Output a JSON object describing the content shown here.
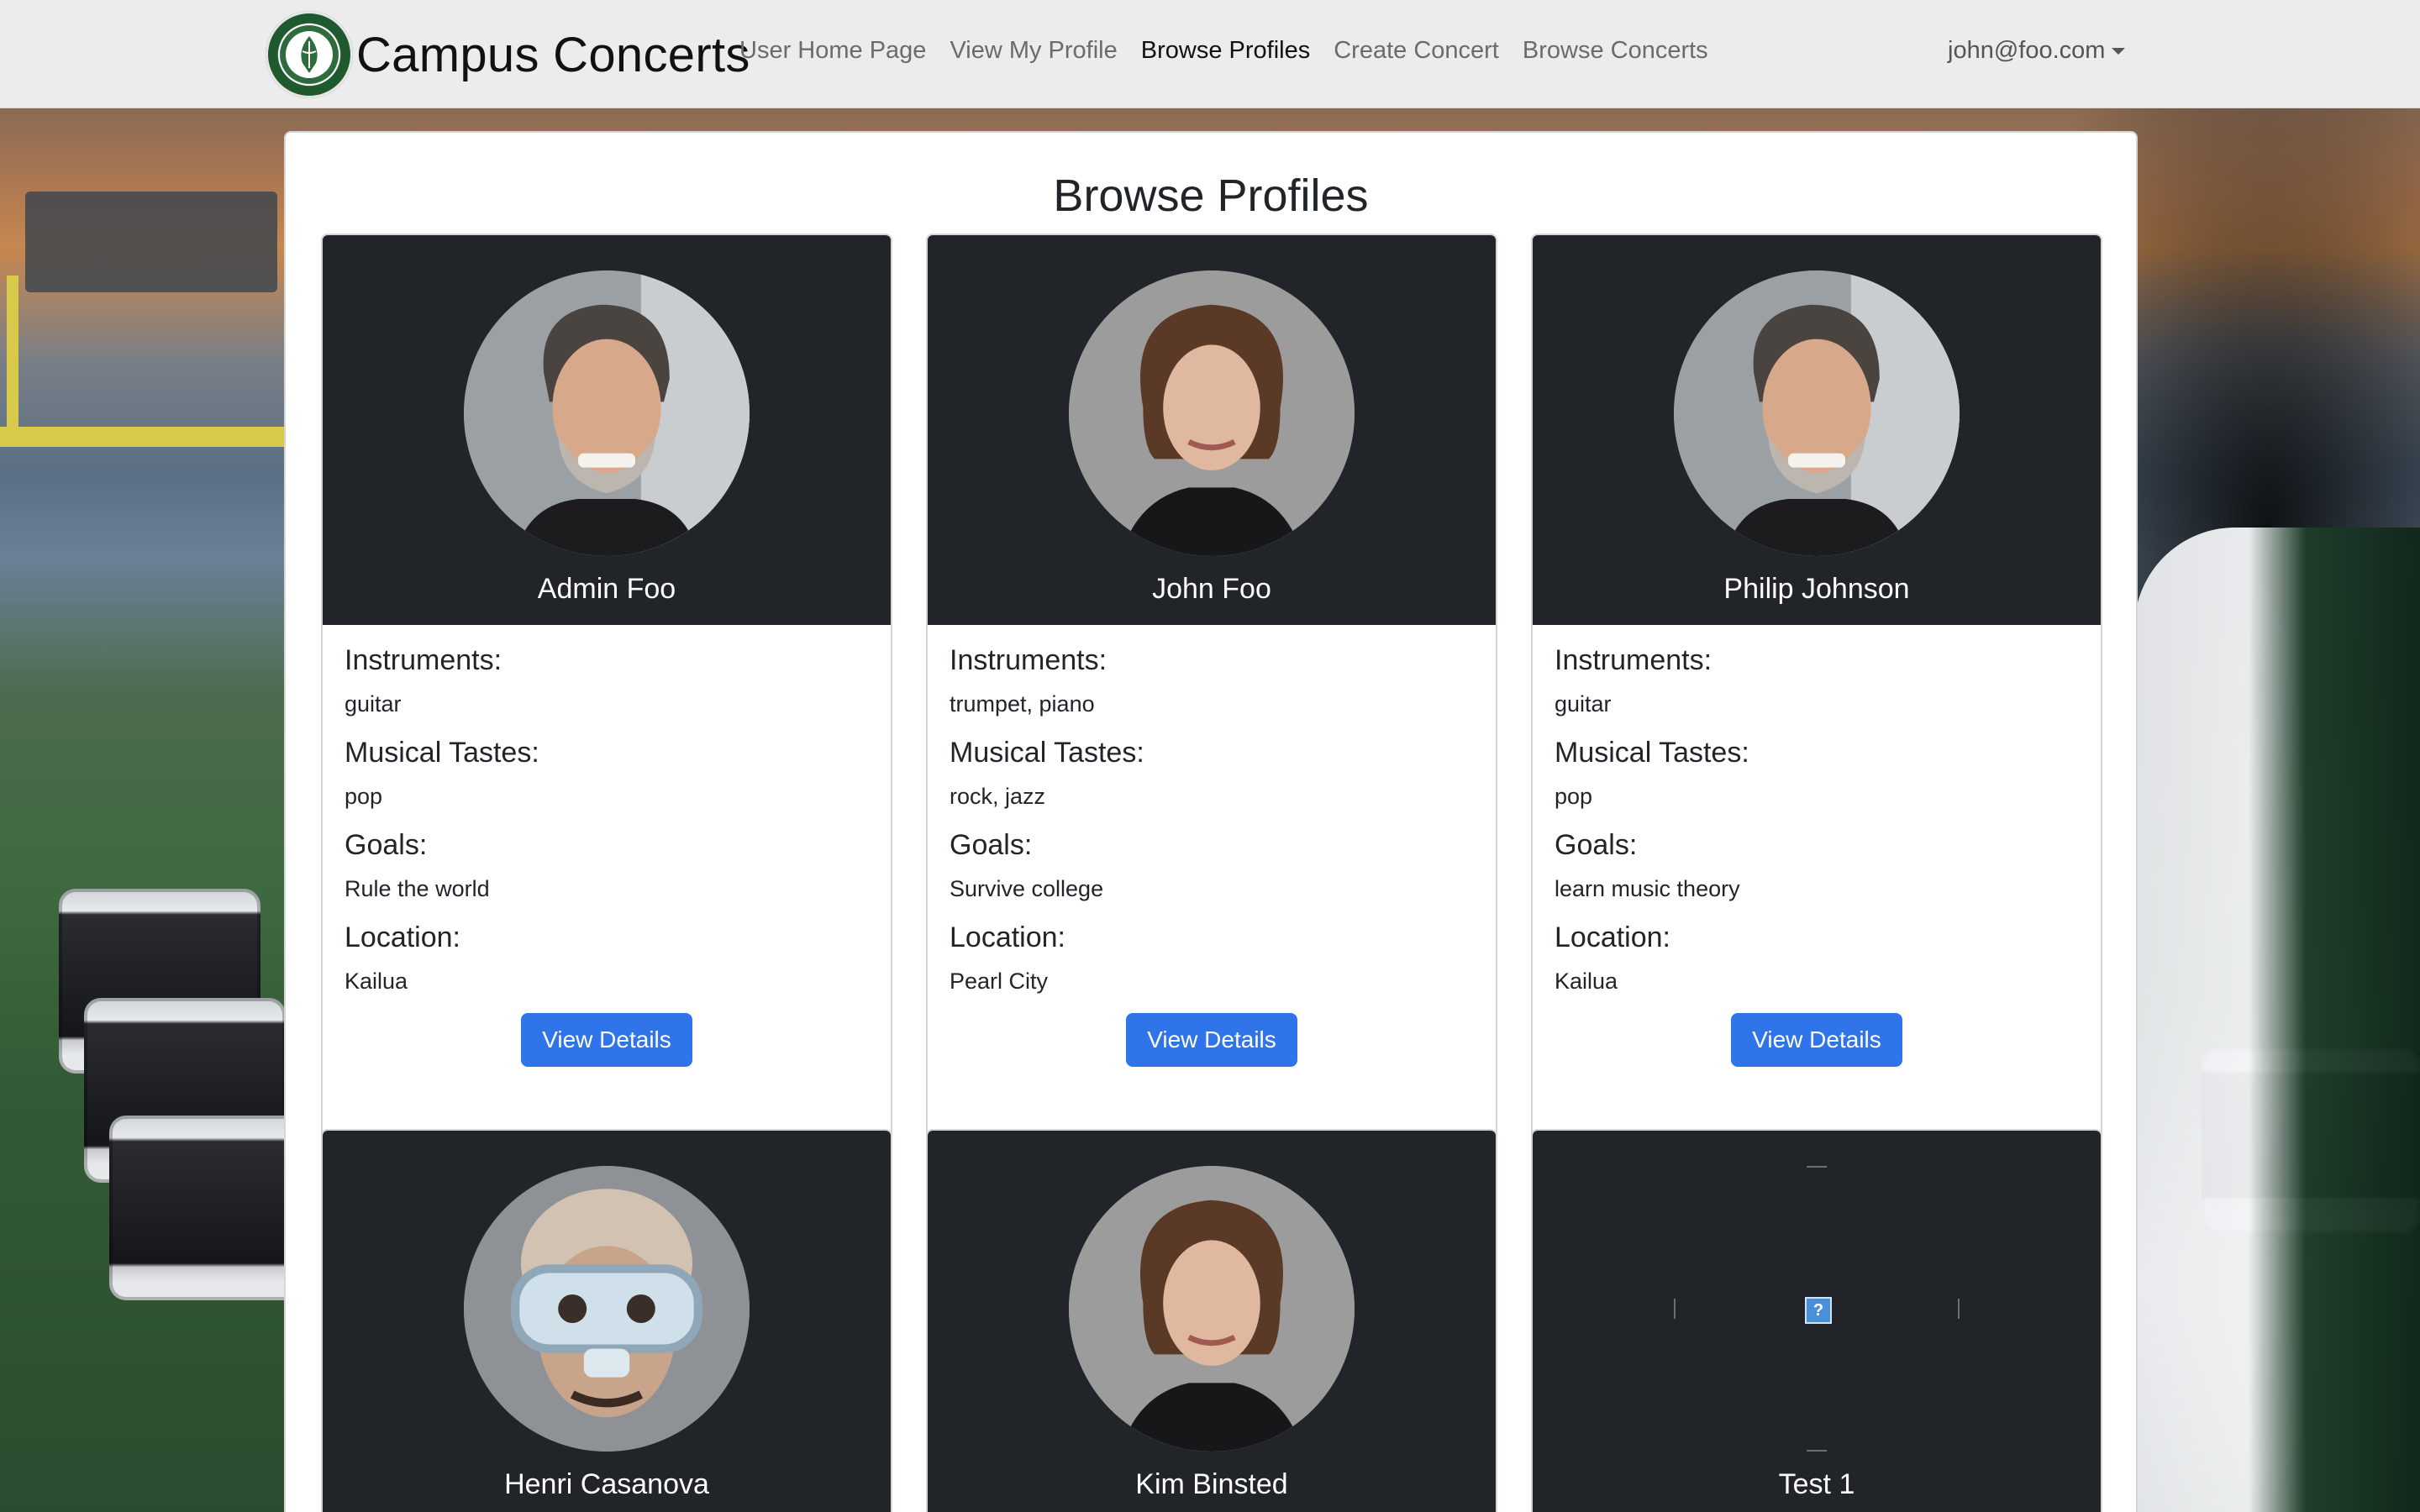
{
  "brand": {
    "title": "Campus Concerts"
  },
  "nav": {
    "links": [
      {
        "label": "User Home Page",
        "active": false
      },
      {
        "label": "View My Profile",
        "active": false
      },
      {
        "label": "Browse Profiles",
        "active": true
      },
      {
        "label": "Create Concert",
        "active": false
      },
      {
        "label": "Browse Concerts",
        "active": false
      }
    ],
    "user": "john@foo.com"
  },
  "page": {
    "title": "Browse Profiles"
  },
  "labels": {
    "instruments": "Instruments:",
    "tastes": "Musical Tastes:",
    "goals": "Goals:",
    "location": "Location:",
    "button": "View Details"
  },
  "profiles": [
    {
      "name": "Admin Foo",
      "instruments": "guitar",
      "tastes": "pop",
      "goals": "Rule the world",
      "location": "Kailua",
      "avatar": "older-man-photo"
    },
    {
      "name": "John Foo",
      "instruments": "trumpet, piano",
      "tastes": "rock, jazz",
      "goals": "Survive college",
      "location": "Pearl City",
      "avatar": "woman-photo"
    },
    {
      "name": "Philip Johnson",
      "instruments": "guitar",
      "tastes": "pop",
      "goals": "learn music theory",
      "location": "Kailua",
      "avatar": "older-man-photo"
    },
    {
      "name": "Henri Casanova",
      "avatar": "diving-mask-photo"
    },
    {
      "name": "Kim Binsted",
      "avatar": "woman-photo"
    },
    {
      "name": "Test 1",
      "avatar": "broken-image"
    }
  ],
  "colors": {
    "navbar": "#ececec",
    "cardHeader": "#212428",
    "button": "#2f74e8"
  }
}
